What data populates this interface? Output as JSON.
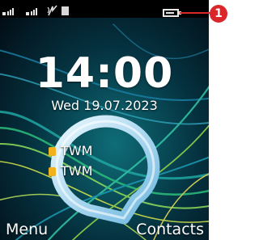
{
  "status_bar": {
    "signal_icons": [
      "sim1-signal-icon",
      "sim2-signal-icon"
    ],
    "network_icon": "network-activity-icon",
    "storage_icon": "sd-card-icon",
    "battery_icon": "battery-icon"
  },
  "clock": {
    "time": "14:00",
    "date": "Wed 19.07.2023"
  },
  "operators": [
    {
      "name": "TWM"
    },
    {
      "name": "TWM"
    }
  ],
  "softkeys": {
    "left": "Menu",
    "right": "Contacts"
  },
  "callout": {
    "number": "1"
  },
  "colors": {
    "callout": "#d8262b",
    "sim_icon": "#f1b01c"
  }
}
